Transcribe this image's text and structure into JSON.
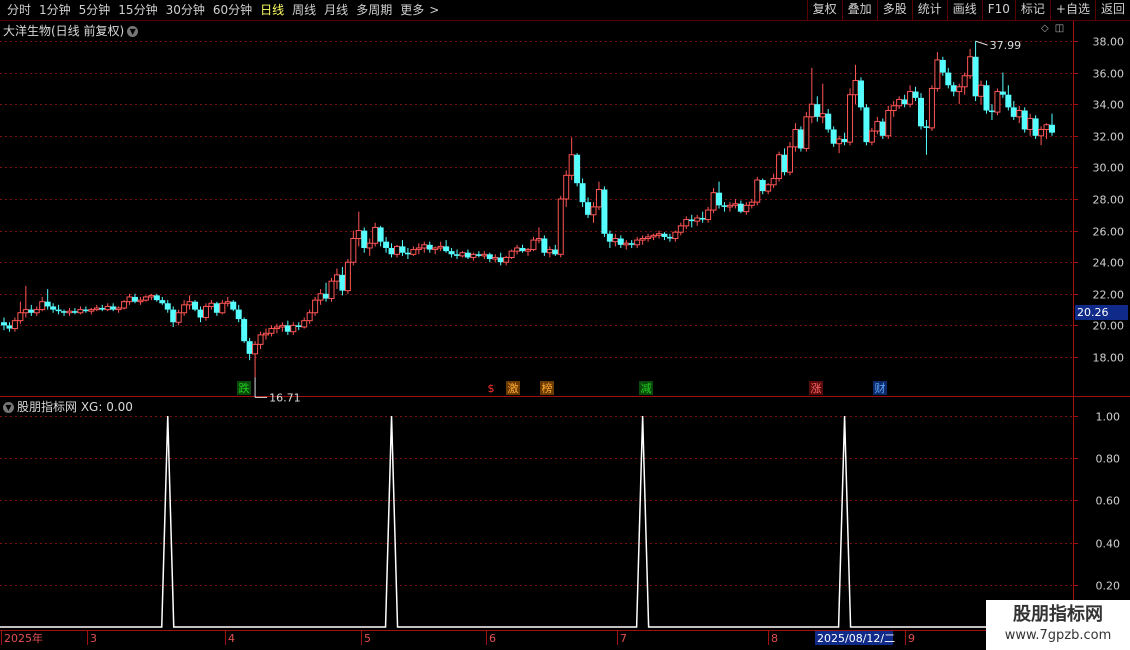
{
  "toolbar": {
    "periods": [
      "分时",
      "1分钟",
      "5分钟",
      "15分钟",
      "30分钟",
      "60分钟",
      "日线",
      "周线",
      "月线",
      "多周期",
      "更多"
    ],
    "active_period": "日线",
    "more_caret": ">",
    "right": [
      "复权",
      "叠加",
      "多股",
      "统计",
      "画线",
      "F10",
      "标记",
      "+自选",
      "返回"
    ]
  },
  "main_panel": {
    "title": "大洋生物(日线 前复权)",
    "price_axis": [
      "38.00",
      "36.00",
      "34.00",
      "32.00",
      "30.00",
      "28.00",
      "26.00",
      "24.00",
      "22.00",
      "20.00",
      "18.00"
    ],
    "current_price": "20.26",
    "high_label": "37.99",
    "low_label": "16.71",
    "event_markers": [
      {
        "text": "跌",
        "color": "#22cc22",
        "bg": "#0a4a0a"
      },
      {
        "text": "$",
        "color": "#ff3333",
        "bg": "#000000"
      },
      {
        "text": "激",
        "color": "#ffaa33",
        "bg": "#6a3a00"
      },
      {
        "text": "榜",
        "color": "#ffaa33",
        "bg": "#6a3a00"
      },
      {
        "text": "减",
        "color": "#22cc22",
        "bg": "#0a4a0a"
      },
      {
        "text": "涨",
        "color": "#ff6666",
        "bg": "#5a0a0a"
      },
      {
        "text": "财",
        "color": "#66aaff",
        "bg": "#0a2a6a"
      }
    ]
  },
  "sub_panel": {
    "title": "股朋指标网 XG: 0.00",
    "axis": [
      "1.00",
      "0.80",
      "0.60",
      "0.40",
      "0.20"
    ]
  },
  "time_axis": {
    "labels": [
      "2025年",
      "3",
      "4",
      "5",
      "6",
      "7",
      "8",
      "9"
    ],
    "cursor_date": "2025/08/12/二"
  },
  "watermark": {
    "line1": "股朋指标网",
    "line2": "www.7gpzb.com"
  },
  "colors": {
    "up": "#ff5555",
    "down": "#55ffff",
    "grid": "#7a1010",
    "axis_line": "#a01010",
    "indicator": "#ffffff"
  },
  "chart_data": {
    "type": "candlestick",
    "price_range": [
      16.0,
      39.0
    ],
    "high": 37.99,
    "low": 16.71,
    "indicator": {
      "name": "XG",
      "value_range": [
        0,
        1
      ],
      "signal_days": [
        30,
        71,
        117,
        154
      ]
    },
    "candles": [
      [
        20.2,
        20.5,
        19.7,
        20.0
      ],
      [
        20.0,
        20.2,
        19.6,
        19.8
      ],
      [
        19.8,
        20.5,
        19.6,
        20.3
      ],
      [
        20.3,
        21.5,
        20.1,
        20.8
      ],
      [
        20.8,
        22.5,
        20.5,
        21.0
      ],
      [
        21.0,
        21.3,
        20.6,
        20.8
      ],
      [
        20.8,
        21.2,
        20.6,
        21.0
      ],
      [
        21.0,
        21.8,
        20.9,
        21.5
      ],
      [
        21.5,
        22.3,
        21.0,
        21.2
      ],
      [
        21.2,
        21.4,
        20.8,
        21.0
      ],
      [
        21.0,
        21.3,
        20.7,
        20.9
      ],
      [
        20.9,
        21.0,
        20.6,
        20.8
      ],
      [
        20.8,
        21.1,
        20.6,
        20.9
      ],
      [
        20.9,
        21.1,
        20.7,
        20.8
      ],
      [
        20.8,
        21.2,
        20.7,
        21.0
      ],
      [
        21.0,
        21.2,
        20.8,
        20.9
      ],
      [
        20.9,
        21.1,
        20.7,
        21.0
      ],
      [
        21.0,
        21.3,
        20.9,
        21.1
      ],
      [
        21.1,
        21.3,
        20.9,
        21.0
      ],
      [
        21.0,
        21.4,
        20.9,
        21.2
      ],
      [
        21.2,
        21.4,
        20.9,
        21.0
      ],
      [
        21.0,
        21.2,
        20.8,
        21.1
      ],
      [
        21.1,
        21.6,
        21.0,
        21.5
      ],
      [
        21.5,
        22.0,
        21.3,
        21.8
      ],
      [
        21.8,
        22.0,
        21.4,
        21.5
      ],
      [
        21.5,
        21.8,
        21.3,
        21.6
      ],
      [
        21.6,
        21.9,
        21.5,
        21.8
      ],
      [
        21.8,
        22.0,
        21.6,
        21.9
      ],
      [
        21.9,
        22.0,
        21.5,
        21.6
      ],
      [
        21.6,
        21.8,
        21.3,
        21.4
      ],
      [
        21.4,
        21.6,
        20.8,
        21.0
      ],
      [
        21.0,
        21.2,
        19.9,
        20.2
      ],
      [
        20.2,
        21.0,
        20.0,
        20.8
      ],
      [
        20.8,
        21.6,
        20.6,
        21.3
      ],
      [
        21.3,
        21.9,
        21.0,
        21.5
      ],
      [
        21.5,
        21.6,
        20.9,
        21.0
      ],
      [
        21.0,
        21.2,
        20.2,
        20.5
      ],
      [
        20.5,
        21.4,
        20.3,
        21.2
      ],
      [
        21.2,
        21.6,
        21.0,
        21.4
      ],
      [
        21.4,
        21.5,
        20.6,
        20.8
      ],
      [
        20.8,
        21.6,
        20.7,
        21.4
      ],
      [
        21.4,
        21.8,
        21.2,
        21.5
      ],
      [
        21.5,
        21.6,
        20.9,
        21.0
      ],
      [
        21.0,
        21.3,
        20.2,
        20.4
      ],
      [
        20.4,
        20.5,
        18.9,
        19.0
      ],
      [
        19.0,
        19.2,
        17.8,
        18.2
      ],
      [
        18.2,
        19.0,
        16.71,
        18.8
      ],
      [
        18.8,
        19.6,
        18.5,
        19.4
      ],
      [
        19.4,
        19.8,
        19.1,
        19.5
      ],
      [
        19.5,
        20.0,
        19.3,
        19.8
      ],
      [
        19.8,
        20.1,
        19.5,
        19.9
      ],
      [
        19.9,
        20.2,
        19.6,
        20.0
      ],
      [
        20.0,
        20.3,
        19.4,
        19.6
      ],
      [
        19.6,
        20.2,
        19.4,
        20.0
      ],
      [
        20.0,
        20.2,
        19.7,
        19.9
      ],
      [
        19.9,
        20.5,
        19.8,
        20.3
      ],
      [
        20.3,
        21.0,
        20.1,
        20.8
      ],
      [
        20.8,
        21.8,
        20.6,
        21.6
      ],
      [
        21.6,
        22.3,
        21.3,
        22.0
      ],
      [
        22.0,
        22.7,
        21.5,
        21.7
      ],
      [
        21.7,
        23.0,
        21.5,
        22.8
      ],
      [
        22.8,
        23.6,
        22.3,
        23.2
      ],
      [
        23.2,
        23.7,
        21.9,
        22.2
      ],
      [
        22.2,
        24.2,
        22.0,
        24.0
      ],
      [
        24.0,
        26.0,
        23.8,
        25.5
      ],
      [
        25.5,
        27.2,
        25.0,
        26.0
      ],
      [
        26.0,
        26.2,
        24.6,
        24.9
      ],
      [
        24.9,
        25.5,
        24.4,
        25.2
      ],
      [
        25.2,
        26.5,
        25.0,
        26.2
      ],
      [
        26.2,
        26.3,
        25.0,
        25.3
      ],
      [
        25.3,
        25.6,
        24.6,
        24.9
      ],
      [
        24.9,
        25.2,
        24.3,
        24.5
      ],
      [
        24.5,
        25.1,
        24.3,
        25.0
      ],
      [
        25.0,
        25.4,
        24.4,
        24.6
      ],
      [
        24.6,
        24.9,
        24.2,
        24.5
      ],
      [
        24.5,
        25.0,
        24.4,
        24.8
      ],
      [
        24.8,
        25.2,
        24.5,
        24.9
      ],
      [
        24.9,
        25.3,
        24.6,
        25.1
      ],
      [
        25.1,
        25.3,
        24.6,
        24.8
      ],
      [
        24.8,
        25.0,
        24.5,
        24.9
      ],
      [
        24.9,
        25.3,
        24.7,
        25.0
      ],
      [
        25.0,
        25.4,
        24.6,
        24.7
      ],
      [
        24.7,
        24.9,
        24.3,
        24.5
      ],
      [
        24.5,
        24.8,
        24.2,
        24.4
      ],
      [
        24.4,
        24.7,
        24.3,
        24.6
      ],
      [
        24.6,
        24.8,
        24.2,
        24.3
      ],
      [
        24.3,
        24.6,
        24.1,
        24.5
      ],
      [
        24.5,
        24.7,
        24.3,
        24.4
      ],
      [
        24.4,
        24.7,
        24.2,
        24.5
      ],
      [
        24.5,
        24.6,
        24.0,
        24.2
      ],
      [
        24.2,
        24.5,
        24.0,
        24.3
      ],
      [
        24.3,
        24.6,
        23.8,
        24.0
      ],
      [
        24.0,
        24.4,
        23.8,
        24.3
      ],
      [
        24.3,
        24.8,
        24.2,
        24.7
      ],
      [
        24.7,
        25.1,
        24.5,
        24.9
      ],
      [
        24.9,
        25.1,
        24.6,
        24.7
      ],
      [
        24.7,
        24.9,
        24.4,
        24.8
      ],
      [
        24.8,
        25.6,
        24.7,
        25.4
      ],
      [
        25.4,
        26.2,
        25.2,
        25.5
      ],
      [
        25.5,
        25.7,
        24.4,
        24.6
      ],
      [
        24.6,
        25.0,
        24.3,
        24.8
      ],
      [
        24.8,
        25.1,
        24.4,
        24.5
      ],
      [
        24.5,
        28.2,
        24.3,
        28.0
      ],
      [
        28.0,
        29.8,
        27.5,
        29.5
      ],
      [
        29.5,
        31.9,
        29.2,
        30.8
      ],
      [
        30.8,
        30.9,
        28.8,
        29.0
      ],
      [
        29.0,
        29.3,
        27.5,
        27.8
      ],
      [
        27.8,
        28.1,
        26.8,
        27.0
      ],
      [
        27.0,
        27.8,
        26.5,
        27.5
      ],
      [
        27.5,
        29.1,
        27.3,
        28.6
      ],
      [
        28.6,
        28.8,
        25.6,
        25.8
      ],
      [
        25.8,
        26.0,
        24.9,
        25.3
      ],
      [
        25.3,
        25.8,
        25.0,
        25.5
      ],
      [
        25.5,
        25.7,
        24.9,
        25.1
      ],
      [
        25.1,
        25.4,
        24.8,
        25.2
      ],
      [
        25.2,
        25.4,
        24.9,
        25.1
      ],
      [
        25.1,
        25.6,
        24.9,
        25.4
      ],
      [
        25.4,
        25.7,
        25.1,
        25.5
      ],
      [
        25.5,
        25.8,
        25.3,
        25.6
      ],
      [
        25.6,
        25.8,
        25.4,
        25.7
      ],
      [
        25.7,
        26.0,
        25.5,
        25.8
      ],
      [
        25.8,
        25.9,
        25.4,
        25.6
      ],
      [
        25.6,
        25.8,
        25.3,
        25.5
      ],
      [
        25.5,
        26.0,
        25.3,
        25.9
      ],
      [
        25.9,
        26.5,
        25.7,
        26.3
      ],
      [
        26.3,
        26.9,
        26.1,
        26.7
      ],
      [
        26.7,
        27.0,
        26.2,
        26.6
      ],
      [
        26.6,
        27.0,
        26.3,
        26.8
      ],
      [
        26.8,
        27.2,
        26.5,
        26.7
      ],
      [
        26.7,
        27.5,
        26.5,
        27.3
      ],
      [
        27.3,
        28.7,
        27.1,
        28.4
      ],
      [
        28.4,
        29.1,
        27.4,
        27.6
      ],
      [
        27.6,
        27.8,
        27.2,
        27.5
      ],
      [
        27.5,
        27.8,
        27.2,
        27.6
      ],
      [
        27.6,
        28.0,
        27.4,
        27.7
      ],
      [
        27.7,
        27.9,
        27.1,
        27.2
      ],
      [
        27.2,
        27.8,
        27.0,
        27.6
      ],
      [
        27.6,
        28.0,
        27.4,
        27.8
      ],
      [
        27.8,
        29.4,
        27.6,
        29.2
      ],
      [
        29.2,
        29.3,
        28.3,
        28.5
      ],
      [
        28.5,
        29.0,
        28.3,
        28.9
      ],
      [
        28.9,
        29.6,
        28.7,
        29.3
      ],
      [
        29.3,
        31.0,
        29.1,
        30.8
      ],
      [
        30.8,
        31.2,
        29.5,
        29.7
      ],
      [
        29.7,
        31.6,
        29.5,
        31.3
      ],
      [
        31.3,
        32.8,
        31.0,
        32.4
      ],
      [
        32.4,
        32.6,
        31.0,
        31.2
      ],
      [
        31.2,
        33.5,
        31.0,
        33.2
      ],
      [
        33.2,
        36.3,
        32.8,
        34.0
      ],
      [
        34.0,
        34.5,
        32.9,
        33.2
      ],
      [
        33.2,
        35.3,
        32.8,
        33.4
      ],
      [
        33.4,
        33.7,
        32.2,
        32.4
      ],
      [
        32.4,
        32.6,
        31.3,
        31.5
      ],
      [
        31.5,
        32.0,
        30.9,
        31.8
      ],
      [
        31.8,
        32.2,
        31.4,
        31.6
      ],
      [
        31.6,
        35.0,
        31.4,
        34.6
      ],
      [
        34.6,
        36.5,
        34.0,
        35.5
      ],
      [
        35.5,
        35.7,
        33.6,
        33.8
      ],
      [
        33.8,
        34.0,
        31.4,
        31.6
      ],
      [
        31.6,
        32.5,
        31.4,
        32.3
      ],
      [
        32.3,
        33.2,
        32.1,
        32.9
      ],
      [
        32.9,
        33.1,
        31.8,
        32.0
      ],
      [
        32.0,
        33.9,
        31.8,
        33.6
      ],
      [
        33.6,
        34.2,
        33.2,
        33.9
      ],
      [
        33.9,
        34.5,
        33.7,
        34.3
      ],
      [
        34.3,
        34.6,
        33.8,
        34.0
      ],
      [
        34.0,
        35.2,
        33.8,
        34.8
      ],
      [
        34.8,
        35.1,
        34.2,
        34.4
      ],
      [
        34.4,
        34.7,
        32.4,
        32.6
      ],
      [
        32.6,
        33.0,
        30.8,
        32.5
      ],
      [
        32.5,
        35.2,
        32.3,
        35.0
      ],
      [
        35.0,
        37.3,
        34.8,
        36.8
      ],
      [
        36.8,
        37.0,
        35.8,
        36.0
      ],
      [
        36.0,
        36.3,
        35.0,
        35.2
      ],
      [
        35.2,
        35.4,
        34.5,
        34.8
      ],
      [
        34.8,
        35.3,
        34.0,
        35.1
      ],
      [
        35.1,
        36.0,
        34.6,
        35.8
      ],
      [
        35.8,
        37.5,
        35.6,
        37.0
      ],
      [
        37.0,
        37.99,
        34.2,
        34.5
      ],
      [
        34.5,
        35.5,
        34.0,
        35.2
      ],
      [
        35.2,
        35.5,
        33.4,
        33.6
      ],
      [
        33.6,
        34.0,
        33.0,
        33.5
      ],
      [
        33.5,
        35.0,
        33.3,
        34.8
      ],
      [
        34.8,
        36.0,
        34.4,
        34.6
      ],
      [
        34.6,
        35.2,
        33.6,
        33.8
      ],
      [
        33.8,
        34.2,
        33.0,
        33.2
      ],
      [
        33.2,
        33.9,
        32.8,
        33.6
      ],
      [
        33.6,
        33.8,
        32.2,
        32.4
      ],
      [
        32.4,
        33.4,
        32.0,
        33.1
      ],
      [
        33.1,
        33.3,
        31.8,
        32.0
      ],
      [
        32.0,
        32.6,
        31.4,
        32.4
      ],
      [
        32.4,
        32.8,
        31.8,
        32.7
      ],
      [
        32.7,
        33.4,
        32.0,
        32.2
      ]
    ]
  }
}
